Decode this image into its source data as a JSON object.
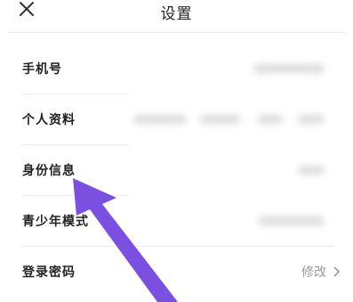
{
  "header": {
    "title": "设置",
    "close_icon": "close-icon"
  },
  "rows": [
    {
      "label": "手机号",
      "value_visible": false
    },
    {
      "label": "个人资料",
      "value_visible": false
    },
    {
      "label": "身份信息",
      "value_visible": false
    },
    {
      "label": "青少年模式",
      "value_visible": false
    },
    {
      "label": "登录密码",
      "value": "修改",
      "chevron_icon": "chevron-right-icon"
    }
  ],
  "annotation": {
    "arrow_color": "#7b4fe0",
    "arrow_icon": "pointer-arrow-icon"
  }
}
